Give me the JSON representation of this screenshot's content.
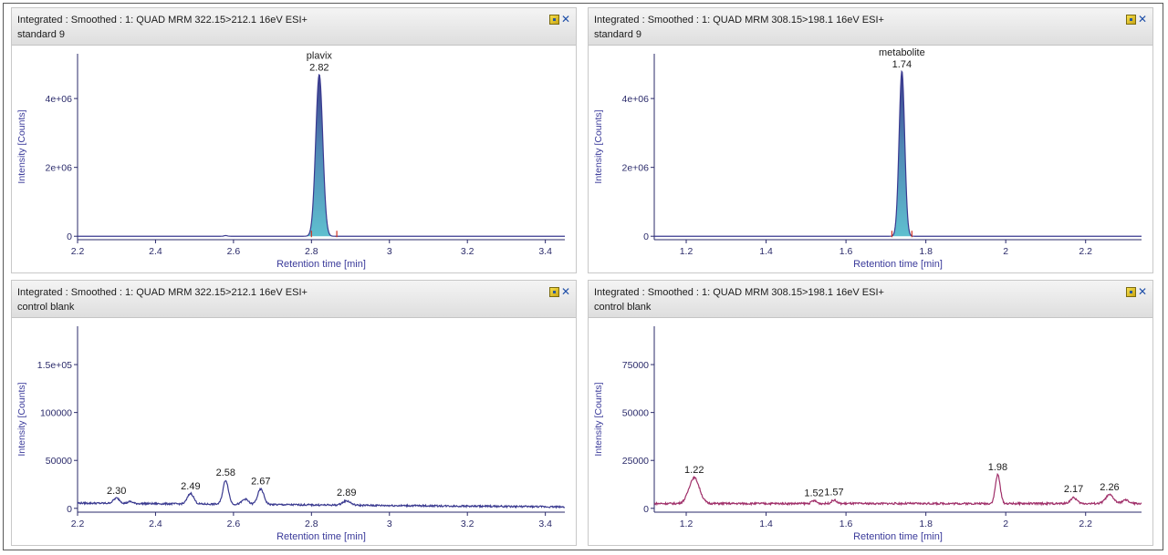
{
  "window": {
    "controls": {
      "pin_icon": "pin-icon",
      "close_icon": "close-icon",
      "close_glyph": "✕"
    }
  },
  "panels": [
    {
      "title": "Integrated : Smoothed :  1: QUAD MRM 322.15>212.1 16eV ESI+",
      "subtitle": "standard 9"
    },
    {
      "title": "Integrated : Smoothed :  1: QUAD MRM 308.15>198.1 16eV ESI+",
      "subtitle": "standard 9"
    },
    {
      "title": "Integrated : Smoothed :  1: QUAD MRM 322.15>212.1 16eV ESI+",
      "subtitle": "control blank"
    },
    {
      "title": "Integrated : Smoothed :  1: QUAD MRM 308.15>198.1 16eV ESI+",
      "subtitle": "control blank"
    }
  ],
  "chart_data": [
    {
      "type": "line",
      "xlabel": "Retention time [min]",
      "ylabel": "Intensity [Counts]",
      "xlim": [
        2.2,
        3.45
      ],
      "ylim": [
        -100000,
        5300000
      ],
      "x_ticks": [
        2.2,
        2.4,
        2.6,
        2.8,
        3,
        3.2,
        3.4
      ],
      "x_tick_labels": [
        "2.2",
        "2.4",
        "2.6",
        "2.8",
        "3",
        "3.2",
        "3.4"
      ],
      "y_ticks": [
        0,
        2000000,
        4000000
      ],
      "y_tick_labels": [
        "0",
        "2e+06",
        "4e+06"
      ],
      "line_color": "#3a3a90",
      "fill_color": "#5fbfcf",
      "baseline": 0,
      "peaks": [
        {
          "rt": 2.82,
          "height": 4700000,
          "width": 0.009,
          "filled": true
        },
        {
          "rt": 2.58,
          "height": 20000,
          "width": 0.004,
          "filled": false
        }
      ],
      "integration_limits": [
        2.8,
        2.865
      ],
      "annotations": [
        {
          "name": "plavix",
          "rt_label": "2.82",
          "rt": 2.82,
          "height": 4700000
        }
      ]
    },
    {
      "type": "line",
      "xlabel": "Retention time [min]",
      "ylabel": "Intensity [Counts]",
      "xlim": [
        1.12,
        2.34
      ],
      "ylim": [
        -100000,
        5300000
      ],
      "x_ticks": [
        1.2,
        1.4,
        1.6,
        1.8,
        2,
        2.2
      ],
      "x_tick_labels": [
        "1.2",
        "1.4",
        "1.6",
        "1.8",
        "2",
        "2.2"
      ],
      "y_ticks": [
        0,
        2000000,
        4000000
      ],
      "y_tick_labels": [
        "0",
        "2e+06",
        "4e+06"
      ],
      "line_color": "#3a3a90",
      "fill_color": "#5fbfcf",
      "baseline": 0,
      "peaks": [
        {
          "rt": 1.74,
          "height": 4800000,
          "width": 0.007,
          "filled": true
        }
      ],
      "integration_limits": [
        1.715,
        1.765
      ],
      "annotations": [
        {
          "name": "metabolite",
          "rt_label": "1.74",
          "rt": 1.74,
          "height": 4800000
        }
      ]
    },
    {
      "type": "line",
      "xlabel": "Retention time [min]",
      "ylabel": "Intensity [Counts]",
      "xlim": [
        2.2,
        3.45
      ],
      "ylim": [
        -4000,
        190000
      ],
      "x_ticks": [
        2.2,
        2.4,
        2.6,
        2.8,
        3,
        3.2,
        3.4
      ],
      "x_tick_labels": [
        "2.2",
        "2.4",
        "2.6",
        "2.8",
        "3",
        "3.2",
        "3.4"
      ],
      "y_ticks": [
        0,
        50000,
        100000,
        150000
      ],
      "y_tick_labels": [
        "0",
        "50000",
        "100000",
        "1.5e+05"
      ],
      "line_color": "#3a3a90",
      "baseline": 5500,
      "baseline_end": 1500,
      "noise": 900,
      "peaks": [
        {
          "rt": 2.3,
          "height": 5500,
          "width": 0.008
        },
        {
          "rt": 2.335,
          "height": 2000,
          "width": 0.006
        },
        {
          "rt": 2.49,
          "height": 11000,
          "width": 0.008
        },
        {
          "rt": 2.58,
          "height": 25000,
          "width": 0.007
        },
        {
          "rt": 2.63,
          "height": 5500,
          "width": 0.008
        },
        {
          "rt": 2.67,
          "height": 16000,
          "width": 0.008
        },
        {
          "rt": 2.89,
          "height": 4500,
          "width": 0.01
        }
      ],
      "annotations": [
        {
          "rt_label": "2.30",
          "rt": 2.3,
          "height": 11000
        },
        {
          "rt_label": "2.49",
          "rt": 2.49,
          "height": 16000
        },
        {
          "rt_label": "2.58",
          "rt": 2.58,
          "height": 30000
        },
        {
          "rt_label": "2.67",
          "rt": 2.67,
          "height": 21000
        },
        {
          "rt_label": "2.89",
          "rt": 2.89,
          "height": 9500
        }
      ]
    },
    {
      "type": "line",
      "xlabel": "Retention time [min]",
      "ylabel": "Intensity [Counts]",
      "xlim": [
        1.12,
        2.34
      ],
      "ylim": [
        -2000,
        95000
      ],
      "x_ticks": [
        1.2,
        1.4,
        1.6,
        1.8,
        2,
        2.2
      ],
      "x_tick_labels": [
        "1.2",
        "1.4",
        "1.6",
        "1.8",
        "2",
        "2.2"
      ],
      "y_ticks": [
        0,
        25000,
        50000,
        75000
      ],
      "y_tick_labels": [
        "0",
        "25000",
        "50000",
        "75000"
      ],
      "line_color": "#a0306a",
      "baseline": 2500,
      "baseline_end": 2500,
      "noise": 500,
      "peaks": [
        {
          "rt": 1.22,
          "height": 13500,
          "width": 0.013
        },
        {
          "rt": 1.52,
          "height": 1500,
          "width": 0.006
        },
        {
          "rt": 1.57,
          "height": 1800,
          "width": 0.006
        },
        {
          "rt": 1.98,
          "height": 15000,
          "width": 0.006
        },
        {
          "rt": 2.17,
          "height": 3000,
          "width": 0.008
        },
        {
          "rt": 2.26,
          "height": 4500,
          "width": 0.01
        },
        {
          "rt": 2.3,
          "height": 1800,
          "width": 0.008
        }
      ],
      "annotations": [
        {
          "rt_label": "1.22",
          "rt": 1.22,
          "height": 16500
        },
        {
          "rt_label": "1.52",
          "rt": 1.52,
          "height": 4500
        },
        {
          "rt_label": "1.57",
          "rt": 1.57,
          "height": 4800
        },
        {
          "rt_label": "1.98",
          "rt": 1.98,
          "height": 18000
        },
        {
          "rt_label": "2.17",
          "rt": 2.17,
          "height": 6500
        },
        {
          "rt_label": "2.26",
          "rt": 2.26,
          "height": 7500
        }
      ]
    }
  ]
}
